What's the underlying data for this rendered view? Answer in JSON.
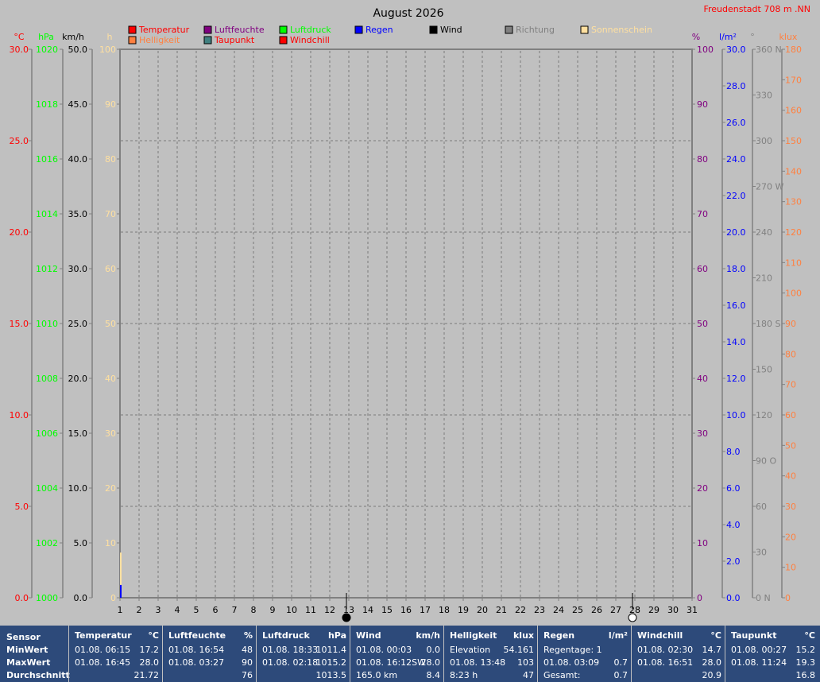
{
  "header": {
    "title": "August 2026",
    "location": "Freudenstadt 708 m  .NN"
  },
  "legend": [
    {
      "label": "Temperatur",
      "color": "#ff0000",
      "text_color": "#ff0000"
    },
    {
      "label": "Luftfeuchte",
      "color": "#800080",
      "text_color": "#800080"
    },
    {
      "label": "Luftdruck",
      "color": "#00ff00",
      "text_color": "#00ff00"
    },
    {
      "label": "Regen",
      "color": "#0000ff",
      "text_color": "#0000ff"
    },
    {
      "label": "Wind",
      "color": "#000000",
      "text_color": "#000000"
    },
    {
      "label": "Richtung",
      "color": "#808080",
      "text_color": "#808080"
    },
    {
      "label": "Sonnenschein",
      "color": "#ffe0a0",
      "text_color": "#ffe0a0"
    },
    {
      "label": "Helligkeit",
      "color": "#ff8040",
      "text_color": "#ff8040"
    },
    {
      "label": "Taupunkt",
      "color": "#408080",
      "text_color": "#ff0000"
    },
    {
      "label": "Windchill",
      "color": "#ff0000",
      "text_color": "#ff0000"
    }
  ],
  "chart_data": {
    "type": "bar",
    "x": {
      "min": 1,
      "max": 31,
      "ticks": [
        "1",
        "2",
        "3",
        "4",
        "5",
        "6",
        "7",
        "8",
        "9",
        "10",
        "11",
        "12",
        "13",
        "14",
        "15",
        "16",
        "17",
        "18",
        "19",
        "20",
        "21",
        "22",
        "23",
        "24",
        "25",
        "26",
        "27",
        "28",
        "29",
        "30",
        "31"
      ]
    },
    "axes": {
      "temperature": {
        "unit": "°C",
        "min": 0,
        "max": 30,
        "ticks": [
          "0.0",
          "5.0",
          "10.0",
          "15.0",
          "20.0",
          "25.0",
          "30.0"
        ],
        "color": "#ff0000"
      },
      "pressure": {
        "unit": "hPa",
        "min": 1000,
        "max": 1020,
        "ticks": [
          "1000",
          "1002",
          "1004",
          "1006",
          "1008",
          "1010",
          "1012",
          "1014",
          "1016",
          "1018",
          "1020"
        ],
        "color": "#00ff00"
      },
      "wind": {
        "unit": "km/h",
        "min": 0,
        "max": 50,
        "ticks": [
          "0.0",
          "5.0",
          "10.0",
          "15.0",
          "20.0",
          "25.0",
          "30.0",
          "35.0",
          "40.0",
          "45.0",
          "50.0"
        ],
        "color": "#000000"
      },
      "sunshine": {
        "unit": "h",
        "min": 0,
        "max": 100,
        "ticks": [
          "0",
          "10",
          "20",
          "30",
          "40",
          "50",
          "60",
          "70",
          "80",
          "90",
          "100"
        ],
        "color": "#ffe0a0"
      },
      "humidity": {
        "unit": "%",
        "min": 0,
        "max": 100,
        "ticks": [
          "0",
          "10",
          "20",
          "30",
          "40",
          "50",
          "60",
          "70",
          "80",
          "90",
          "100"
        ],
        "color": "#800080"
      },
      "rain": {
        "unit": "l/m²",
        "min": 0,
        "max": 30,
        "ticks": [
          "0.0",
          "2.0",
          "4.0",
          "6.0",
          "8.0",
          "10.0",
          "12.0",
          "14.0",
          "16.0",
          "18.0",
          "20.0",
          "22.0",
          "24.0",
          "26.0",
          "28.0",
          "30.0"
        ],
        "color": "#0000ff"
      },
      "direction": {
        "unit": "°",
        "min": 0,
        "max": 360,
        "ticks": [
          "0  N",
          "30",
          "60",
          "90  O",
          "120",
          "150",
          "180  S",
          "210",
          "240",
          "270  W",
          "300",
          "330",
          "360  N"
        ],
        "color": "#808080"
      },
      "brightness": {
        "unit": "klux",
        "min": 0,
        "max": 180,
        "ticks": [
          "0",
          "10",
          "20",
          "30",
          "40",
          "50",
          "60",
          "70",
          "80",
          "90",
          "100",
          "110",
          "120",
          "130",
          "140",
          "150",
          "160",
          "170",
          "180"
        ],
        "color": "#ff8040"
      }
    },
    "series": [
      {
        "name": "Sonnenschein",
        "axis": "sunshine",
        "points": [
          {
            "x": 1,
            "y": 8.23
          }
        ],
        "color": "#ffe0a0"
      },
      {
        "name": "Regen",
        "axis": "rain",
        "points": [
          {
            "x": 1,
            "y": 0.7
          }
        ],
        "color": "#0000ff"
      }
    ],
    "moon_phases": [
      {
        "phase": "new",
        "x": 13
      },
      {
        "phase": "full",
        "x": 28
      }
    ]
  },
  "stats": {
    "row_labels": [
      "Sensor",
      "MinWert",
      "MaxWert",
      "Durchschnitt"
    ],
    "blocks": [
      {
        "name": "Temperatur",
        "unit": "°C",
        "rows": [
          [
            "01.08.  06:15",
            "17.2"
          ],
          [
            "01.08.  16:45",
            "28.0"
          ],
          [
            "",
            "21.72"
          ]
        ]
      },
      {
        "name": "Luftfeuchte",
        "unit": "%",
        "rows": [
          [
            "01.08.  16:54",
            "48"
          ],
          [
            "01.08.  03:27",
            "90"
          ],
          [
            "",
            "76"
          ]
        ]
      },
      {
        "name": "Luftdruck",
        "unit": "hPa",
        "rows": [
          [
            "01.08.  18:33",
            "1011.4"
          ],
          [
            "01.08.  02:18",
            "1015.2"
          ],
          [
            "",
            "1013.5"
          ]
        ]
      },
      {
        "name": "Wind",
        "unit": "km/h",
        "rows": [
          [
            "01.08.  00:03",
            "0.0"
          ],
          [
            "01.08.  16:12SW",
            "28.0"
          ],
          [
            "165.0 km",
            "8.4"
          ]
        ]
      },
      {
        "name": "Helligkeit",
        "unit": "klux",
        "rows": [
          [
            "Elevation",
            "54.161"
          ],
          [
            "01.08.  13:48",
            "103"
          ],
          [
            "8:23 h",
            "47"
          ]
        ]
      },
      {
        "name": "Regen",
        "unit": "l/m²",
        "rows": [
          [
            "Regentage: 1",
            ""
          ],
          [
            "01.08.  03:09",
            "0.7"
          ],
          [
            "Gesamt:",
            "0.7"
          ]
        ]
      },
      {
        "name": "Windchill",
        "unit": "°C",
        "rows": [
          [
            "01.08.  02:30",
            "14.7"
          ],
          [
            "01.08.  16:51",
            "28.0"
          ],
          [
            "",
            "20.9"
          ]
        ]
      },
      {
        "name": "Taupunkt",
        "unit": "°C",
        "rows": [
          [
            "01.08.  00:27",
            "15.2"
          ],
          [
            "01.08.  11:24",
            "19.3"
          ],
          [
            "",
            "16.8"
          ]
        ]
      }
    ]
  }
}
